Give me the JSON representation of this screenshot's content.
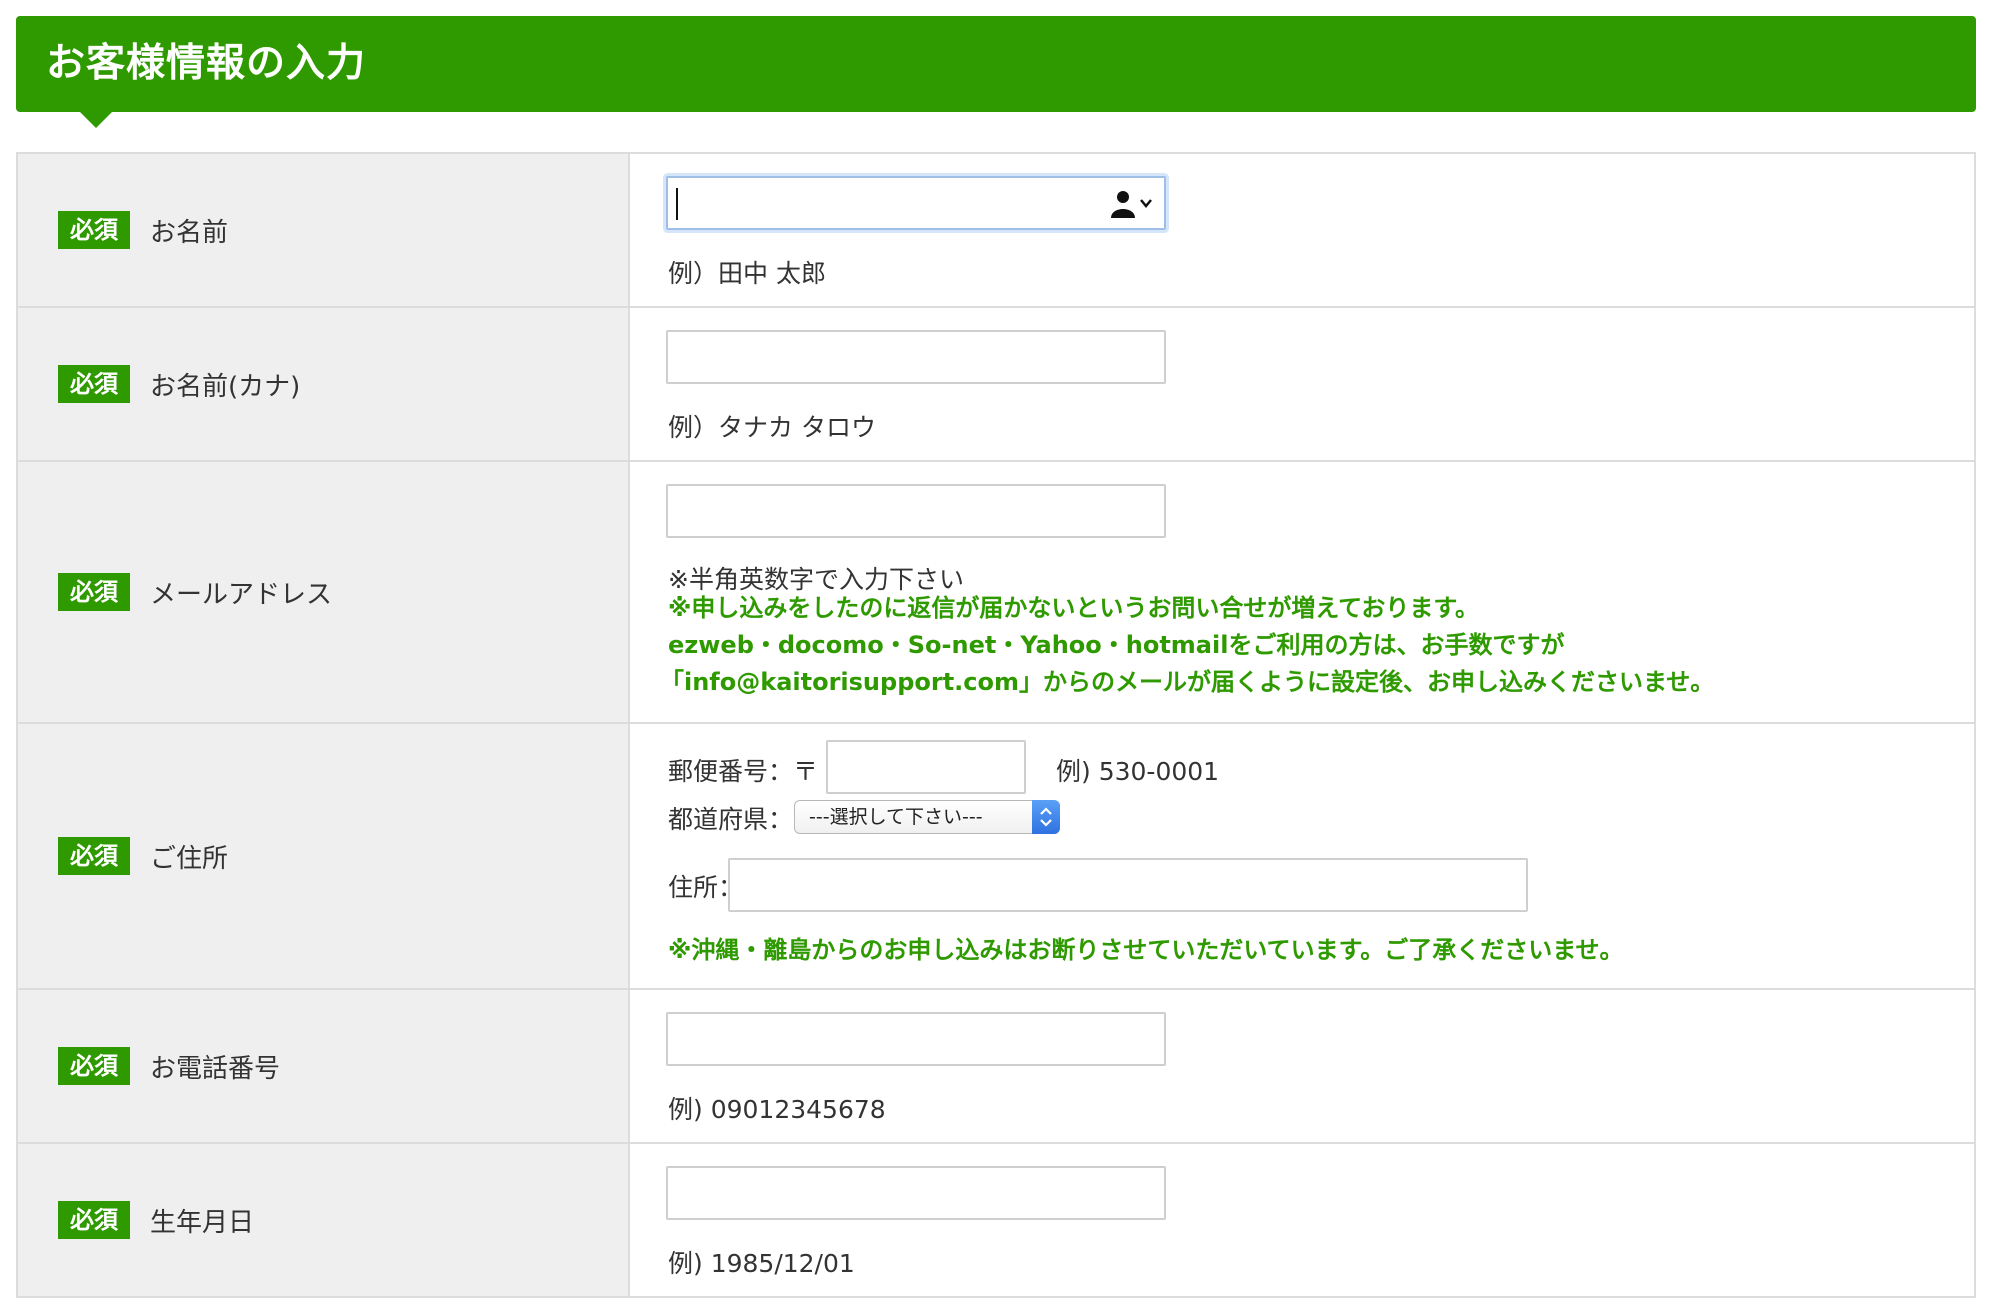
{
  "header": {
    "title": "お客様情報の入力"
  },
  "required_badge": "必須",
  "fields": {
    "name": {
      "label": "お名前",
      "value": "",
      "hint": "例）田中 太郎",
      "autofill_icon": "contact-autofill-icon"
    },
    "kana": {
      "label": "お名前(カナ)",
      "value": "",
      "hint": "例）タナカ タロウ"
    },
    "email": {
      "label": "メールアドレス",
      "value": "",
      "note": "※半角英数字で入力下さい",
      "warning_lines": [
        "※申し込みをしたのに返信が届かないというお問い合せが増えております。",
        "ezweb・docomo・So-net・Yahoo・hotmailをご利用の方は、お手数ですが",
        "「info@kaitorisupport.com」からのメールが届くように設定後、お申し込みくださいませ。"
      ]
    },
    "address": {
      "label": "ご住所",
      "postal_label": "郵便番号：〒",
      "postal_value": "",
      "postal_hint": "例) 530-0001",
      "prefecture_label": "都道府県：",
      "prefecture_selected": "---選択して下さい---",
      "address_label": "住所：",
      "address_value": "",
      "warning": "※沖縄・離島からのお申し込みはお断りさせていただいています。ご了承くださいませ。"
    },
    "phone": {
      "label": "お電話番号",
      "value": "",
      "hint": "例) 09012345678"
    },
    "birthday": {
      "label": "生年月日",
      "value": "",
      "hint": "例) 1985/12/01"
    }
  },
  "colors": {
    "accent": "#2e9a00",
    "label_bg": "#efefef",
    "border": "#dcdcdc"
  }
}
